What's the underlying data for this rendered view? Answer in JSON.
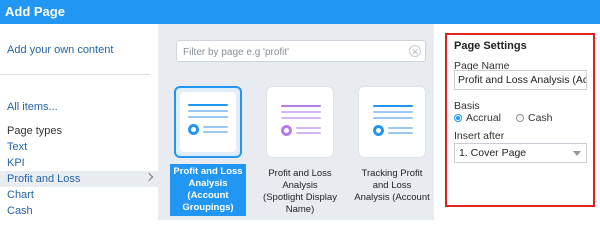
{
  "header": {
    "title": "Add Page"
  },
  "sidebar": {
    "add_own_content": "Add your own content",
    "all_items": "All items...",
    "page_types_title": "Page types",
    "items": [
      {
        "label": "Text"
      },
      {
        "label": "KPI"
      },
      {
        "label": "Profit and Loss"
      },
      {
        "label": "Chart"
      },
      {
        "label": "Cash"
      }
    ]
  },
  "search": {
    "placeholder": "Filter by page e.g 'profit'"
  },
  "cards": [
    {
      "label": "Profit and Loss Analysis (Account Groupings)",
      "accent": "#2196f3"
    },
    {
      "label": "Profit and Loss Analysis (Spotlight Display Name)",
      "accent": "#b47ee8"
    },
    {
      "label": "Tracking Profit and Loss Analysis (Account",
      "accent": "#2196f3"
    }
  ],
  "page_settings": {
    "title": "Page Settings",
    "page_name_label": "Page Name",
    "page_name_value": "Profit and Loss Analysis (Account Groupings)",
    "basis_label": "Basis",
    "basis_options": [
      "Accrual",
      "Cash"
    ],
    "basis_selected": "Accrual",
    "insert_after_label": "Insert after",
    "insert_after_value": "1. Cover Page"
  },
  "colors": {
    "header": "#2196f3",
    "highlight_box": "#e0221e"
  }
}
